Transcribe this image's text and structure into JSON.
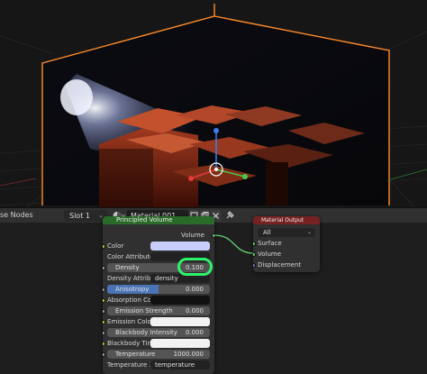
{
  "header": {
    "editor_title": "se Nodes",
    "slot": "Slot 1",
    "material_name": "Material.001"
  },
  "node_volume": {
    "title": "Principled Volume",
    "output_volume": "Volume",
    "rows": {
      "color": "Color",
      "color_attribute": "Color Attribute",
      "density_label": "Density",
      "density_value": "0.100",
      "density_attrib_label": "Density Attrib...",
      "density_attrib_value": "density",
      "anisotropy_label": "Anisotropy",
      "anisotropy_value": "0.000",
      "absorption_label": "Absorption Co...",
      "emission_strength_label": "Emission Strength",
      "emission_strength_value": "0.000",
      "emission_color": "Emission Color",
      "blackbody_intensity_label": "Blackbody Intensity",
      "blackbody_intensity_value": "0.000",
      "blackbody_tint": "Blackbody Tint",
      "temperature_label": "Temperature",
      "temperature_value": "1000.000",
      "temperature_attr_label": "Temperature ...",
      "temperature_attr_value": "temperature"
    }
  },
  "node_output": {
    "title": "Material Output",
    "target": "All",
    "inputs": [
      "Surface",
      "Volume",
      "Displacement"
    ]
  },
  "colors": {
    "volume_header": "#2a6b2a",
    "output_header": "#772222",
    "highlight": "#2cf46a",
    "selection_outline": "#ff8a2a",
    "socket_yellow": "#c7c729",
    "socket_grey": "#a1a1a1",
    "socket_green": "#5fcf74",
    "socket_blue": "#6d72c6",
    "color_swatch": "#c9cdfa",
    "anisotropy_fill": "#4a73b8"
  }
}
